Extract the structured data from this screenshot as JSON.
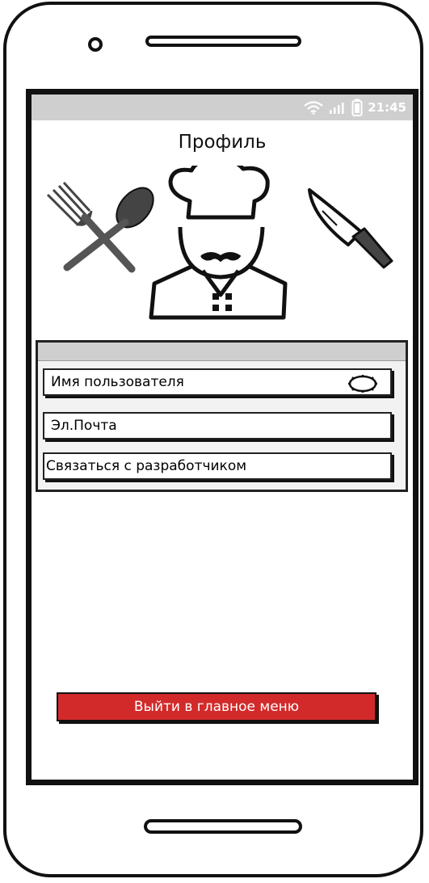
{
  "status_bar": {
    "time": "21:45",
    "icons": [
      "wifi-icon",
      "signal-icon",
      "battery-icon"
    ]
  },
  "header": {
    "title": "Профиль"
  },
  "illustration": {
    "icons": [
      "fork-spoon-icon",
      "chef-icon",
      "knife-icon"
    ]
  },
  "profile_panel": {
    "items": [
      {
        "label": "Имя пользователя",
        "icon": "gear-icon"
      },
      {
        "label": "Эл.Почта"
      },
      {
        "label": "Связаться с разработчиком"
      }
    ]
  },
  "footer": {
    "exit_label": "Выйти в главное меню"
  },
  "colors": {
    "status_bar": "#cfcfcf",
    "accent_button": "#d22a2a",
    "outline": "#111111"
  }
}
